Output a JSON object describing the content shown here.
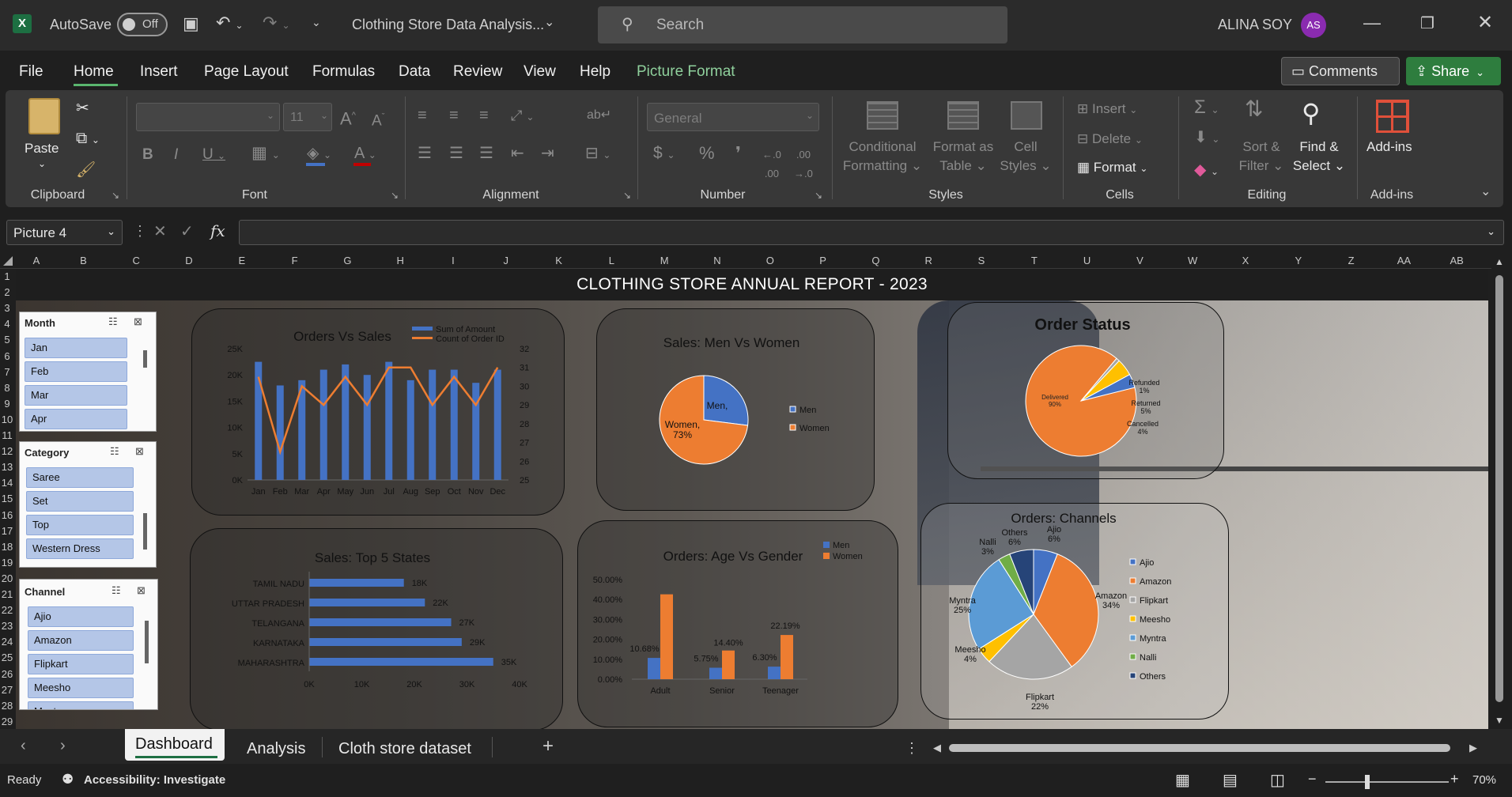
{
  "titlebar": {
    "autosave_label": "AutoSave",
    "toggle_state": "Off",
    "doc_title": "Clothing Store Data Analysis...",
    "search_placeholder": "Search",
    "user_name": "ALINA SOY",
    "user_initials": "AS"
  },
  "menu": [
    "File",
    "Home",
    "Insert",
    "Page Layout",
    "Formulas",
    "Data",
    "Review",
    "View",
    "Help",
    "Picture Format"
  ],
  "comments_label": "Comments",
  "share_label": "Share",
  "ribbon": {
    "paste": "Paste",
    "clipboard": "Clipboard",
    "font_group": "Font",
    "font_size": "11",
    "alignment": "Alignment",
    "number_format": "General",
    "number_group": "Number",
    "conditional": "Conditional",
    "formatting": "Formatting",
    "format_as": "Format as",
    "table": "Table",
    "cell": "Cell",
    "styles": "Styles",
    "styles_group": "Styles",
    "insert": "Insert",
    "delete": "Delete",
    "format": "Format",
    "cells_group": "Cells",
    "sort": "Sort &",
    "filter": "Filter",
    "find": "Find &",
    "select": "Select",
    "editing_group": "Editing",
    "addins": "Add-ins",
    "addins_group": "Add-ins"
  },
  "formula": {
    "name_box": "Picture 4",
    "fx": "fx"
  },
  "columns": [
    "A",
    "B",
    "C",
    "D",
    "E",
    "F",
    "G",
    "H",
    "I",
    "J",
    "K",
    "L",
    "M",
    "N",
    "O",
    "P",
    "Q",
    "R",
    "S",
    "T",
    "U",
    "V",
    "W",
    "X",
    "Y",
    "Z",
    "AA",
    "AB"
  ],
  "rows": [
    "1",
    "2",
    "3",
    "4",
    "5",
    "6",
    "7",
    "8",
    "9",
    "10",
    "11",
    "12",
    "13",
    "14",
    "15",
    "16",
    "17",
    "18",
    "19",
    "20",
    "21",
    "22",
    "23",
    "24",
    "25",
    "26",
    "27",
    "28",
    "29"
  ],
  "dashboard": {
    "title": "CLOTHING STORE ANNUAL REPORT - 2023",
    "slicers": [
      {
        "title": "Month",
        "items": [
          "Jan",
          "Feb",
          "Mar",
          "Apr"
        ]
      },
      {
        "title": "Category",
        "items": [
          "Saree",
          "Set",
          "Top",
          "Western Dress"
        ]
      },
      {
        "title": "Channel",
        "items": [
          "Ajio",
          "Amazon",
          "Flipkart",
          "Meesho",
          "Myntra"
        ]
      }
    ]
  },
  "chart_data": [
    {
      "type": "bar",
      "title": "Orders Vs Sales",
      "categories": [
        "Jan",
        "Feb",
        "Mar",
        "Apr",
        "May",
        "Jun",
        "Jul",
        "Aug",
        "Sep",
        "Oct",
        "Nov",
        "Dec"
      ],
      "series": [
        {
          "name": "Sum of Amount",
          "values": [
            22500,
            18000,
            19000,
            21000,
            22000,
            20000,
            22500,
            19000,
            21000,
            21000,
            18500,
            21000
          ],
          "color": "#4472c4"
        },
        {
          "name": "Count of Order ID",
          "values": [
            30.5,
            26.5,
            30,
            29,
            30.5,
            29,
            31,
            31,
            29,
            30.5,
            29,
            31
          ],
          "color": "#ed7d31"
        }
      ],
      "y_ticks": [
        "0K",
        "5K",
        "10K",
        "15K",
        "20K",
        "25K"
      ],
      "y2_ticks": [
        "25",
        "26",
        "27",
        "28",
        "29",
        "30",
        "31",
        "32"
      ],
      "ylim": [
        0,
        25000
      ],
      "y2lim": [
        25,
        32
      ]
    },
    {
      "type": "pie",
      "title": "Sales: Men Vs Women",
      "labels": [
        "Men",
        "Women"
      ],
      "values": [
        27,
        73
      ],
      "data_labels": [
        "Men,",
        "Women,\n73%"
      ],
      "colors": [
        "#4472c4",
        "#ed7d31"
      ]
    },
    {
      "type": "pie",
      "title": "Order Status",
      "labels": [
        "Delivered",
        "Refunded",
        "Returned",
        "Cancelled"
      ],
      "values": [
        90,
        1,
        5,
        4
      ],
      "data_labels": [
        "Delivered\n90%",
        "Refunded\n1%",
        "Returned\n5%",
        "Cancelled\n4%"
      ],
      "colors": [
        "#ed7d31",
        "#a5a5a5",
        "#ffc000",
        "#4472c4"
      ]
    },
    {
      "type": "bar",
      "title": "Sales: Top 5 States",
      "categories": [
        "TAMIL NADU",
        "UTTAR PRADESH",
        "TELANGANA",
        "KARNATAKA",
        "MAHARASHTRA"
      ],
      "values": [
        18000,
        22000,
        27000,
        29000,
        35000
      ],
      "data_labels": [
        "18K",
        "22K",
        "27K",
        "29K",
        "35K"
      ],
      "x_ticks": [
        "0K",
        "10K",
        "20K",
        "30K",
        "40K"
      ],
      "xlim": [
        0,
        40000
      ]
    },
    {
      "type": "bar",
      "title": "Orders: Age Vs Gender",
      "categories": [
        "Adult",
        "Senior",
        "Teenager"
      ],
      "series": [
        {
          "name": "Men",
          "values": [
            10.68,
            5.75,
            6.3
          ],
          "color": "#4472c4"
        },
        {
          "name": "Women",
          "values": [
            42.6,
            14.4,
            22.19
          ],
          "color": "#ed7d31"
        }
      ],
      "data_labels": [
        "10.68%",
        "5.75%",
        "6.30%",
        "22.19%",
        "14.40%"
      ],
      "y_ticks": [
        "0.00%",
        "10.00%",
        "20.00%",
        "30.00%",
        "40.00%",
        "50.00%"
      ],
      "ylim": [
        0,
        50
      ]
    },
    {
      "type": "pie",
      "title": "Orders: Channels",
      "labels": [
        "Ajio",
        "Amazon",
        "Flipkart",
        "Meesho",
        "Myntra",
        "Nalli",
        "Others"
      ],
      "values": [
        6,
        34,
        22,
        4,
        25,
        3,
        6
      ],
      "data_labels": [
        "Ajio\n6%",
        "Amazon\n34%",
        "Flipkart\n22%",
        "Meesho\n4%",
        "Myntra\n25%",
        "Nalli\n3%",
        "Others\n6%"
      ],
      "colors": [
        "#4472c4",
        "#ed7d31",
        "#a5a5a5",
        "#ffc000",
        "#5b9bd5",
        "#70ad47",
        "#264478"
      ]
    }
  ],
  "sheets": [
    "Dashboard",
    "Analysis",
    "Cloth store dataset"
  ],
  "status": {
    "ready": "Ready",
    "accessibility": "Accessibility: Investigate",
    "zoom": "70%"
  }
}
